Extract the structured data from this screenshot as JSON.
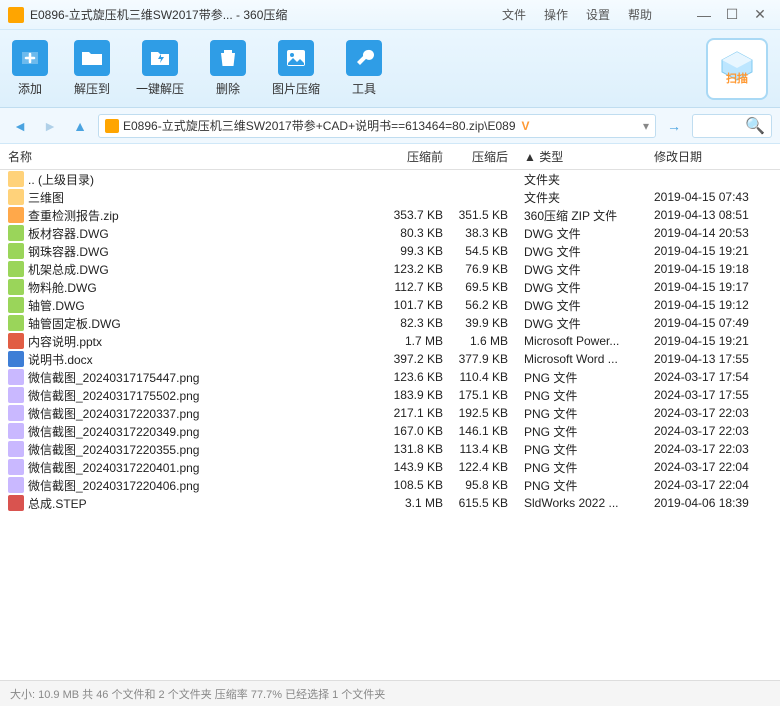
{
  "window": {
    "title": "E0896-立式旋压机三维SW2017带参... - 360压缩"
  },
  "menus": [
    "文件",
    "操作",
    "设置",
    "帮助"
  ],
  "toolbar": [
    {
      "label": "添加",
      "color": "#2f9de6",
      "glyph": "add"
    },
    {
      "label": "解压到",
      "color": "#2f9de6",
      "glyph": "folder"
    },
    {
      "label": "一键解压",
      "color": "#2f9de6",
      "glyph": "bolt"
    },
    {
      "label": "删除",
      "color": "#2f9de6",
      "glyph": "trash"
    },
    {
      "label": "图片压缩",
      "color": "#2f9de6",
      "glyph": "image"
    },
    {
      "label": "工具",
      "color": "#2f9de6",
      "glyph": "wrench"
    }
  ],
  "scan_label": "扫描",
  "path": "E0896-立式旋压机三维SW2017带参+CAD+说明书==613464=80.zip\\E089",
  "vip_badge": "V",
  "columns": {
    "name": "名称",
    "before": "压缩前",
    "after": "压缩后",
    "type": "▲ 类型",
    "date": "修改日期"
  },
  "files": [
    {
      "icon": "#ffd27a",
      "name": ".. (上级目录)",
      "before": "",
      "after": "",
      "type": "文件夹",
      "date": ""
    },
    {
      "icon": "#ffd27a",
      "name": "三维图",
      "before": "",
      "after": "",
      "type": "文件夹",
      "date": "2019-04-15 07:43"
    },
    {
      "icon": "#ffa84a",
      "name": "查重检测报告.zip",
      "before": "353.7 KB",
      "after": "351.5 KB",
      "type": "360压缩 ZIP 文件",
      "date": "2019-04-13 08:51"
    },
    {
      "icon": "#9ad55a",
      "name": "板材容器.DWG",
      "before": "80.3 KB",
      "after": "38.3 KB",
      "type": "DWG 文件",
      "date": "2019-04-14 20:53"
    },
    {
      "icon": "#9ad55a",
      "name": "钢珠容器.DWG",
      "before": "99.3 KB",
      "after": "54.5 KB",
      "type": "DWG 文件",
      "date": "2019-04-15 19:21"
    },
    {
      "icon": "#9ad55a",
      "name": "机架总成.DWG",
      "before": "123.2 KB",
      "after": "76.9 KB",
      "type": "DWG 文件",
      "date": "2019-04-15 19:18"
    },
    {
      "icon": "#9ad55a",
      "name": "物料舱.DWG",
      "before": "112.7 KB",
      "after": "69.5 KB",
      "type": "DWG 文件",
      "date": "2019-04-15 19:17"
    },
    {
      "icon": "#9ad55a",
      "name": "轴管.DWG",
      "before": "101.7 KB",
      "after": "56.2 KB",
      "type": "DWG 文件",
      "date": "2019-04-15 19:12"
    },
    {
      "icon": "#9ad55a",
      "name": "轴管固定板.DWG",
      "before": "82.3 KB",
      "after": "39.9 KB",
      "type": "DWG 文件",
      "date": "2019-04-15 07:49"
    },
    {
      "icon": "#e15d44",
      "name": "内容说明.pptx",
      "before": "1.7 MB",
      "after": "1.6 MB",
      "type": "Microsoft Power...",
      "date": "2019-04-15 19:21"
    },
    {
      "icon": "#3e7ed6",
      "name": "说明书.docx",
      "before": "397.2 KB",
      "after": "377.9 KB",
      "type": "Microsoft Word ...",
      "date": "2019-04-13 17:55"
    },
    {
      "icon": "#c9b8ff",
      "name": "微信截图_20240317175447.png",
      "before": "123.6 KB",
      "after": "110.4 KB",
      "type": "PNG 文件",
      "date": "2024-03-17 17:54"
    },
    {
      "icon": "#c9b8ff",
      "name": "微信截图_20240317175502.png",
      "before": "183.9 KB",
      "after": "175.1 KB",
      "type": "PNG 文件",
      "date": "2024-03-17 17:55"
    },
    {
      "icon": "#c9b8ff",
      "name": "微信截图_20240317220337.png",
      "before": "217.1 KB",
      "after": "192.5 KB",
      "type": "PNG 文件",
      "date": "2024-03-17 22:03"
    },
    {
      "icon": "#c9b8ff",
      "name": "微信截图_20240317220349.png",
      "before": "167.0 KB",
      "after": "146.1 KB",
      "type": "PNG 文件",
      "date": "2024-03-17 22:03"
    },
    {
      "icon": "#c9b8ff",
      "name": "微信截图_20240317220355.png",
      "before": "131.8 KB",
      "after": "113.4 KB",
      "type": "PNG 文件",
      "date": "2024-03-17 22:03"
    },
    {
      "icon": "#c9b8ff",
      "name": "微信截图_20240317220401.png",
      "before": "143.9 KB",
      "after": "122.4 KB",
      "type": "PNG 文件",
      "date": "2024-03-17 22:04"
    },
    {
      "icon": "#c9b8ff",
      "name": "微信截图_20240317220406.png",
      "before": "108.5 KB",
      "after": "95.8 KB",
      "type": "PNG 文件",
      "date": "2024-03-17 22:04"
    },
    {
      "icon": "#d9534f",
      "name": "总成.STEP",
      "before": "3.1 MB",
      "after": "615.5 KB",
      "type": "SldWorks 2022 ...",
      "date": "2019-04-06 18:39"
    }
  ],
  "status": "大小: 10.9 MB 共 46 个文件和 2 个文件夹 压缩率 77.7% 已经选择 1 个文件夹"
}
